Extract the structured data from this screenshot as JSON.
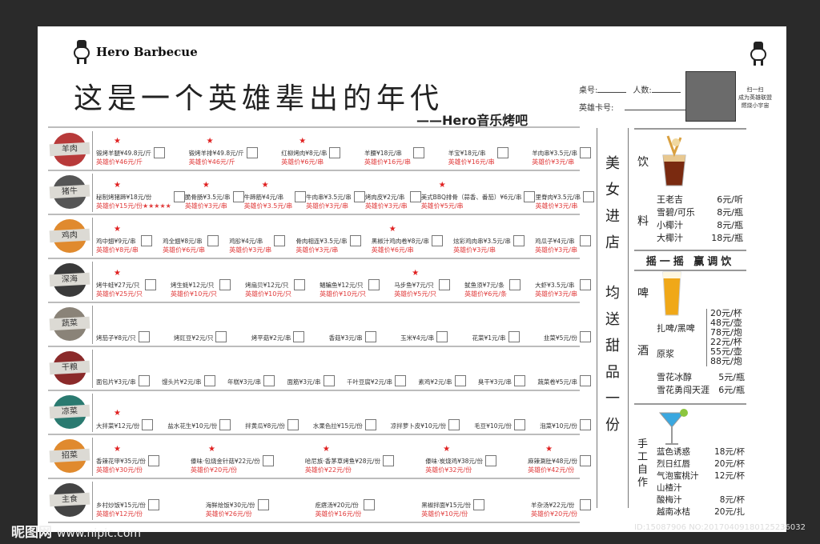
{
  "header": {
    "logo": "Hero Barbecue",
    "title": "这是一个英雄辈出的年代",
    "subtitle": "——Hero音乐烤吧",
    "table_label": "桌号:",
    "people_label": "人数:",
    "card_label": "英雄卡号:",
    "qr_caption": [
      "扫一扫",
      "成为英雄联盟",
      "燃烧小宇宙"
    ]
  },
  "categories": [
    {
      "name": "羊肉",
      "color": "#b83a3a",
      "items": [
        {
          "name": "锻烤羊腿¥49.8元/斤",
          "hero": "英雄价¥46元/斤",
          "star": true
        },
        {
          "name": "锻烤羊排¥49.8元/斤",
          "hero": "英雄价¥46元/斤",
          "star": true
        },
        {
          "name": "红柳烤肉¥8元/串",
          "hero": "英雄价¥6元/串",
          "star": true
        },
        {
          "name": "羊腰¥18元/串",
          "hero": "英雄价¥16元/串"
        },
        {
          "name": "羊宝¥18元/串",
          "hero": "英雄价¥16元/串"
        },
        {
          "name": "羊肉串¥3.5元/串",
          "hero": "英雄价¥3元/串"
        }
      ]
    },
    {
      "name": "猪牛",
      "color": "#555555",
      "items": [
        {
          "name": "秘制烤猪蹄¥18元/份",
          "hero": "英雄价¥15元/份★★★★★",
          "star": true
        },
        {
          "name": "脆骨肠¥3.5元/串",
          "hero": "英雄价¥3元/串",
          "star": true
        },
        {
          "name": "牛蹄筋¥4元/串",
          "hero": "英雄价¥3.5元/串",
          "star": true
        },
        {
          "name": "牛肉串¥3.5元/串",
          "hero": "英雄价¥3元/串"
        },
        {
          "name": "烤肉皮¥2元/串",
          "hero": "英雄价¥3元/串"
        },
        {
          "name": "美式BBQ排骨（蒜香、番茄）¥6元/串",
          "hero": "英雄价¥5元/串",
          "star": true
        },
        {
          "name": "里脊肉¥3.5元/串",
          "hero": "英雄价¥3元/串"
        }
      ]
    },
    {
      "name": "鸡肉",
      "color": "#e08a2e",
      "items": [
        {
          "name": "鸡中翅¥9元/串",
          "hero": "英雄价¥8元/串",
          "star": true
        },
        {
          "name": "鸡全翅¥8元/串",
          "hero": "英雄价¥6元/串"
        },
        {
          "name": "鸡胗¥4元/串",
          "hero": "英雄价¥3元/串"
        },
        {
          "name": "骨肉相连¥3.5元/串",
          "hero": "英雄价¥3元/串"
        },
        {
          "name": "黑椒汁鸡肉卷¥8元/串",
          "hero": "英雄价¥6元/串",
          "star": true
        },
        {
          "name": "炫彩鸡肉串¥3.5元/串",
          "hero": "英雄价¥3元/串"
        },
        {
          "name": "鸡瓜子¥4元/串",
          "hero": "英雄价¥3元/串"
        }
      ]
    },
    {
      "name": "深海",
      "color": "#3a3a3a",
      "items": [
        {
          "name": "烤牛蛙¥27元/只",
          "hero": "英雄价¥25元/只",
          "star": true
        },
        {
          "name": "烤生蚝¥12元/只",
          "hero": "英雄价¥10元/只"
        },
        {
          "name": "烤扇贝¥12元/只",
          "hero": "英雄价¥10元/只"
        },
        {
          "name": "鲳鳊鱼¥12元/只",
          "hero": "英雄价¥10元/只"
        },
        {
          "name": "马步鱼¥7元/只",
          "hero": "英雄价¥5元/只",
          "star": true
        },
        {
          "name": "鱿鱼须¥7元/条",
          "hero": "英雄价¥6元/条"
        },
        {
          "name": "大虾¥3.5元/串",
          "hero": "英雄价¥3元/串"
        }
      ]
    },
    {
      "name": "蔬菜",
      "color": "#8a8378",
      "items": [
        {
          "name": "烤茄子¥8元/只"
        },
        {
          "name": "烤豇豆¥2元/只"
        },
        {
          "name": "烤平菇¥2元/串"
        },
        {
          "name": "香菇¥3元/串"
        },
        {
          "name": "玉米¥4元/串"
        },
        {
          "name": "花菜¥1元/串"
        },
        {
          "name": "韭菜¥5元/份"
        }
      ]
    },
    {
      "name": "干粮",
      "color": "#8b2a2a",
      "items": [
        {
          "name": "面包片¥3元/串"
        },
        {
          "name": "馒头片¥2元/串"
        },
        {
          "name": "年糕¥3元/串"
        },
        {
          "name": "面筋¥3元/串"
        },
        {
          "name": "千叶豆腐¥2元/串"
        },
        {
          "name": "素鸡¥2元/串"
        },
        {
          "name": "臭干¥3元/串"
        },
        {
          "name": "蔬菜卷¥5元/串"
        }
      ]
    },
    {
      "name": "凉菜",
      "color": "#2a7a70",
      "items": [
        {
          "name": "大拌菜¥12元/份",
          "star": true
        },
        {
          "name": "盐水花生¥10元/份"
        },
        {
          "name": "拌黄瓜¥8元/份"
        },
        {
          "name": "水果色拉¥15元/份"
        },
        {
          "name": "凉拌萝卜皮¥10元/份"
        },
        {
          "name": "毛豆¥10元/份"
        },
        {
          "name": "泡菜¥10元/份"
        }
      ]
    },
    {
      "name": "招菜",
      "color": "#e08a2e",
      "items": [
        {
          "name": "香辣花甲¥35元/份",
          "hero": "英雄价¥30元/份",
          "star": true
        },
        {
          "name": "傣味·包烧金针菇¥22元/份",
          "hero": "英雄价¥20元/份",
          "star": true
        },
        {
          "name": "哈尼族·香茅草烤鱼¥28元/份",
          "hero": "英雄价¥22元/份",
          "star": true
        },
        {
          "name": "傣味·炭烧鸡¥38元/份",
          "hero": "英雄价¥32元/份",
          "star": true
        },
        {
          "name": "麻辣涮肚¥48元/份",
          "hero": "英雄价¥42元/份",
          "star": true
        }
      ]
    },
    {
      "name": "主食",
      "color": "#444444",
      "items": [
        {
          "name": "乡村炒饭¥15元/份",
          "hero": "英雄价¥12元/份"
        },
        {
          "name": "海鲜烩饭¥30元/份",
          "hero": "英雄价¥26元/份"
        },
        {
          "name": "疙瘩汤¥20元/份",
          "hero": "英雄价¥16元/份"
        },
        {
          "name": "黑椒拌面¥15元/份",
          "hero": "英雄价¥10元/份"
        },
        {
          "name": "羊杂汤¥22元/份",
          "hero": "英雄价¥20元/份"
        }
      ]
    }
  ],
  "promo": [
    "美",
    "女",
    "进",
    "店",
    "均",
    "送",
    "甜",
    "品",
    "一",
    "份"
  ],
  "drinks": {
    "side": [
      "饮",
      "料"
    ],
    "items": [
      {
        "name": "王老吉",
        "price": "6元/听"
      },
      {
        "name": "雪碧/可乐",
        "price": "8元/瓶"
      },
      {
        "name": "小椰汁",
        "price": "8元/瓶"
      },
      {
        "name": "大椰汁",
        "price": "18元/瓶"
      }
    ]
  },
  "shake_banner": "摇一摇 赢调饮",
  "beer": {
    "side": [
      "啤",
      "酒"
    ],
    "draft": {
      "name": "扎啤/黑啤",
      "prices": [
        "20元/杯",
        "48元/壶",
        "78元/炮"
      ]
    },
    "raw": {
      "name": "原浆",
      "prices": [
        "22元/杯",
        "55元/壶",
        "88元/炮"
      ]
    },
    "bottles": [
      {
        "name": "雪花冰醇",
        "price": "5元/瓶"
      },
      {
        "name": "雪花勇闯天涯",
        "price": "6元/瓶"
      }
    ]
  },
  "handmade": {
    "side": [
      "手",
      "工",
      "自",
      "作"
    ],
    "items": [
      {
        "name": "蓝色诱惑",
        "price": "18元/杯"
      },
      {
        "name": "烈日红唇",
        "price": "20元/杯"
      },
      {
        "name": "气泡蜜桃汁",
        "price": "12元/杯"
      },
      {
        "name": "山楂汁",
        "price": ""
      },
      {
        "name": "酸梅汁",
        "price": "8元/杯"
      },
      {
        "name": "越南冰桔",
        "price": "20元/扎"
      }
    ]
  },
  "footer": {
    "watermark": "昵图网",
    "url": "www.nipic.com",
    "id": "ID:15087906 NO:20170409180125236032"
  }
}
